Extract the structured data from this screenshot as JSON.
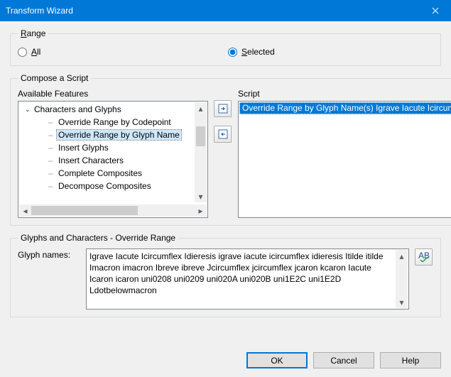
{
  "window": {
    "title": "Transform Wizard"
  },
  "range": {
    "legend_prefix": "R",
    "legend_rest": "ange",
    "all_prefix": "A",
    "all_rest": "ll",
    "selected_prefix": "S",
    "selected_rest": "elected",
    "value": "selected"
  },
  "compose": {
    "legend": "Compose a Script",
    "features_label": "Available Features",
    "script_label": "Script",
    "tree": {
      "root": "Characters and Glyphs",
      "items": [
        "Override Range by Codepoint",
        "Override Range by Glyph Name",
        "Insert Glyphs",
        "Insert Characters",
        "Complete Composites",
        "Decompose Composites"
      ],
      "selected_index": 1
    },
    "script_items": [
      "Override Range by Glyph Name(s) Igrave Iacute Icircumflex"
    ]
  },
  "glyphs": {
    "legend": "Glyphs and Characters - Override Range",
    "label": "Glyph names:",
    "text": "Igrave Iacute Icircumflex Idieresis igrave iacute icircumflex idieresis Itilde itilde Imacron imacron Ibreve ibreve Jcircumflex jcircumflex jcaron kcaron Iacute Icaron icaron uni0208 uni0209 uni020A uni020B uni1E2C uni1E2D Ldotbelowmacron"
  },
  "buttons": {
    "ok": "OK",
    "cancel": "Cancel",
    "help_prefix": "H",
    "help_rest": "elp"
  },
  "icons": {
    "add": "add-icon",
    "remove": "remove-icon",
    "moveup": "move-up-icon",
    "movedown": "move-down-icon",
    "open": "open-icon",
    "save": "save-icon",
    "delete": "delete-icon",
    "spellcheck": "spellcheck-icon"
  }
}
